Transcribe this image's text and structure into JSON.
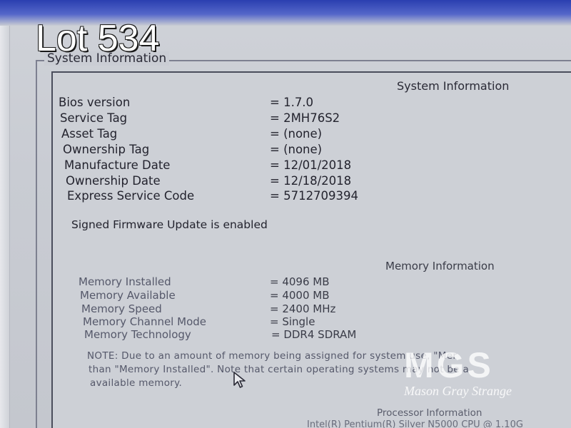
{
  "overlay": {
    "lot_label": "Lot 534"
  },
  "window": {
    "group_title": "System Information"
  },
  "system_info": {
    "heading": "System Information",
    "rows": [
      {
        "label": "Bios version",
        "value": "= 1.7.0"
      },
      {
        "label": "Service Tag",
        "value": "= 2MH76S2"
      },
      {
        "label": "Asset Tag",
        "value": "= (none)"
      },
      {
        "label": "Ownership Tag",
        "value": "= (none)"
      },
      {
        "label": "Manufacture Date",
        "value": "= 12/01/2018"
      },
      {
        "label": "Ownership Date",
        "value": "= 12/18/2018"
      },
      {
        "label": "Express Service Code",
        "value": "= 5712709394"
      }
    ],
    "firmware_status": "Signed Firmware Update is enabled"
  },
  "memory_info": {
    "heading": "Memory Information",
    "rows": [
      {
        "label": "Memory Installed",
        "value": "= 4096 MB"
      },
      {
        "label": "Memory Available",
        "value": "= 4000 MB"
      },
      {
        "label": "Memory Speed",
        "value": "= 2400 MHz"
      },
      {
        "label": "Memory Channel Mode",
        "value": "= Single"
      },
      {
        "label": "Memory Technology",
        "value": "= DDR4 SDRAM"
      }
    ],
    "note_lines": [
      "NOTE: Due to an amount of memory being assigned for system use, \"Mer",
      "than \"Memory Installed\". Note that certain operating systems may not be a",
      "available memory."
    ]
  },
  "processor_info": {
    "heading": "Processor Information",
    "partial_line": "Intel(R) Pentium(R) Silver N5000 CPU @ 1.10G"
  },
  "watermark": {
    "logo": "MGS",
    "name": "Mason Gray Strange"
  },
  "icons": {
    "cursor": "mouse-pointer-icon"
  }
}
